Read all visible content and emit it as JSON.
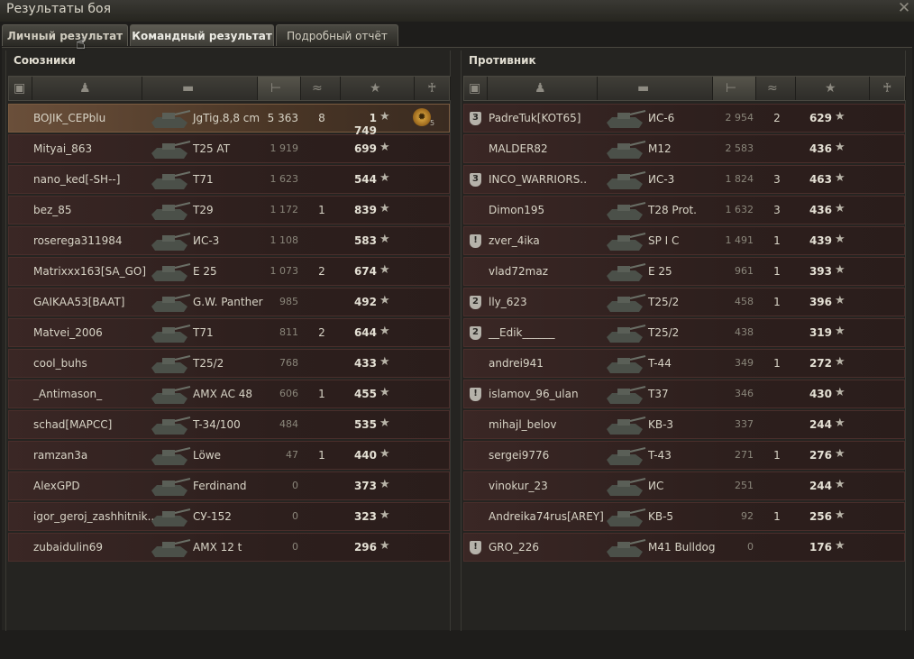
{
  "window": {
    "title": "Результаты боя",
    "close": "✕"
  },
  "tabs": [
    {
      "label": "Личный результат"
    },
    {
      "label": "Командный результат"
    },
    {
      "label": "Подробный отчёт"
    }
  ],
  "left_team": {
    "title": "Союзники",
    "players": [
      {
        "name": "BOJIK_CEPblu",
        "tank": "JgTig.8,8 cm",
        "damage": "5 363",
        "kills": "8",
        "xp": "1 749",
        "medal_count": "5",
        "self": true
      },
      {
        "name": "Mityai_863",
        "tank": "T25 AT",
        "damage": "1 919",
        "kills": "",
        "xp": "699"
      },
      {
        "name": "nano_ked[-SH--]",
        "tank": "T71",
        "damage": "1 623",
        "kills": "",
        "xp": "544"
      },
      {
        "name": "bez_85",
        "tank": "T29",
        "damage": "1 172",
        "kills": "1",
        "xp": "839"
      },
      {
        "name": "roserega311984",
        "tank": "ИС-3",
        "damage": "1 108",
        "kills": "",
        "xp": "583"
      },
      {
        "name": "Matrixxx163[SA_GO]",
        "tank": "E 25",
        "damage": "1 073",
        "kills": "2",
        "xp": "674"
      },
      {
        "name": "GAIKAA53[BAAT]",
        "tank": "G.W. Panther",
        "damage": "985",
        "kills": "",
        "xp": "492"
      },
      {
        "name": "Matvei_2006",
        "tank": "T71",
        "damage": "811",
        "kills": "2",
        "xp": "644"
      },
      {
        "name": "cool_buhs",
        "tank": "T25/2",
        "damage": "768",
        "kills": "",
        "xp": "433"
      },
      {
        "name": "_Antimason_",
        "tank": "AMX AC 48",
        "damage": "606",
        "kills": "1",
        "xp": "455"
      },
      {
        "name": "schad[MAPCC]",
        "tank": "T-34/100",
        "damage": "484",
        "kills": "",
        "xp": "535"
      },
      {
        "name": "ramzan3a",
        "tank": "Löwe",
        "damage": "47",
        "kills": "1",
        "xp": "440"
      },
      {
        "name": "AlexGPD",
        "tank": "Ferdinand",
        "damage": "0",
        "kills": "",
        "xp": "373"
      },
      {
        "name": "igor_geroj_zashhitnik..",
        "tank": "СУ-152",
        "damage": "0",
        "kills": "",
        "xp": "323"
      },
      {
        "name": "zubaidulin69",
        "tank": "AMX 12 t",
        "damage": "0",
        "kills": "",
        "xp": "296"
      }
    ]
  },
  "right_team": {
    "title": "Противник",
    "players": [
      {
        "name": "PadreTuk[KOT65]",
        "badge": "3",
        "tank": "ИС-6",
        "damage": "2 954",
        "kills": "2",
        "xp": "629"
      },
      {
        "name": "MALDER82",
        "tank": "M12",
        "damage": "2 583",
        "kills": "",
        "xp": "436"
      },
      {
        "name": "INCO_WARRIORS..",
        "badge": "3",
        "tank": "ИС-3",
        "damage": "1 824",
        "kills": "3",
        "xp": "463"
      },
      {
        "name": "Dimon195",
        "tank": "T28 Prot.",
        "damage": "1 632",
        "kills": "3",
        "xp": "436"
      },
      {
        "name": "zver_4ika",
        "badge": "!",
        "tank": "SP I C",
        "damage": "1 491",
        "kills": "1",
        "xp": "439"
      },
      {
        "name": "vlad72maz",
        "tank": "E 25",
        "damage": "961",
        "kills": "1",
        "xp": "393"
      },
      {
        "name": "lly_623",
        "badge": "2",
        "tank": "T25/2",
        "damage": "458",
        "kills": "1",
        "xp": "396"
      },
      {
        "name": "__Edik______",
        "badge": "2",
        "tank": "T25/2",
        "damage": "438",
        "kills": "",
        "xp": "319"
      },
      {
        "name": "andrei941",
        "tank": "T-44",
        "damage": "349",
        "kills": "1",
        "xp": "272"
      },
      {
        "name": "islamov_96_ulan",
        "badge": "!",
        "tank": "T37",
        "damage": "346",
        "kills": "",
        "xp": "430"
      },
      {
        "name": "mihajl_belov",
        "tank": "KB-3",
        "damage": "337",
        "kills": "",
        "xp": "244"
      },
      {
        "name": "sergei9776",
        "tank": "T-43",
        "damage": "271",
        "kills": "1",
        "xp": "276"
      },
      {
        "name": "vinokur_23",
        "tank": "ИС",
        "damage": "251",
        "kills": "",
        "xp": "244"
      },
      {
        "name": "Andreika74rus[AREY]",
        "tank": "KB-5",
        "damage": "92",
        "kills": "1",
        "xp": "256"
      },
      {
        "name": "GRO_226",
        "badge": "!",
        "tank": "M41 Bulldog",
        "damage": "0",
        "kills": "",
        "xp": "176"
      }
    ]
  },
  "column_icons": [
    "squad-icon",
    "player-icon",
    "tank-icon",
    "damage-icon",
    "kills-icon",
    "experience-icon",
    "medal-icon"
  ],
  "colors": {
    "background": "#1e1d1b",
    "row": "#2d1f1d",
    "self_row": "#6a4f3a",
    "text": "#d8d4c6"
  }
}
